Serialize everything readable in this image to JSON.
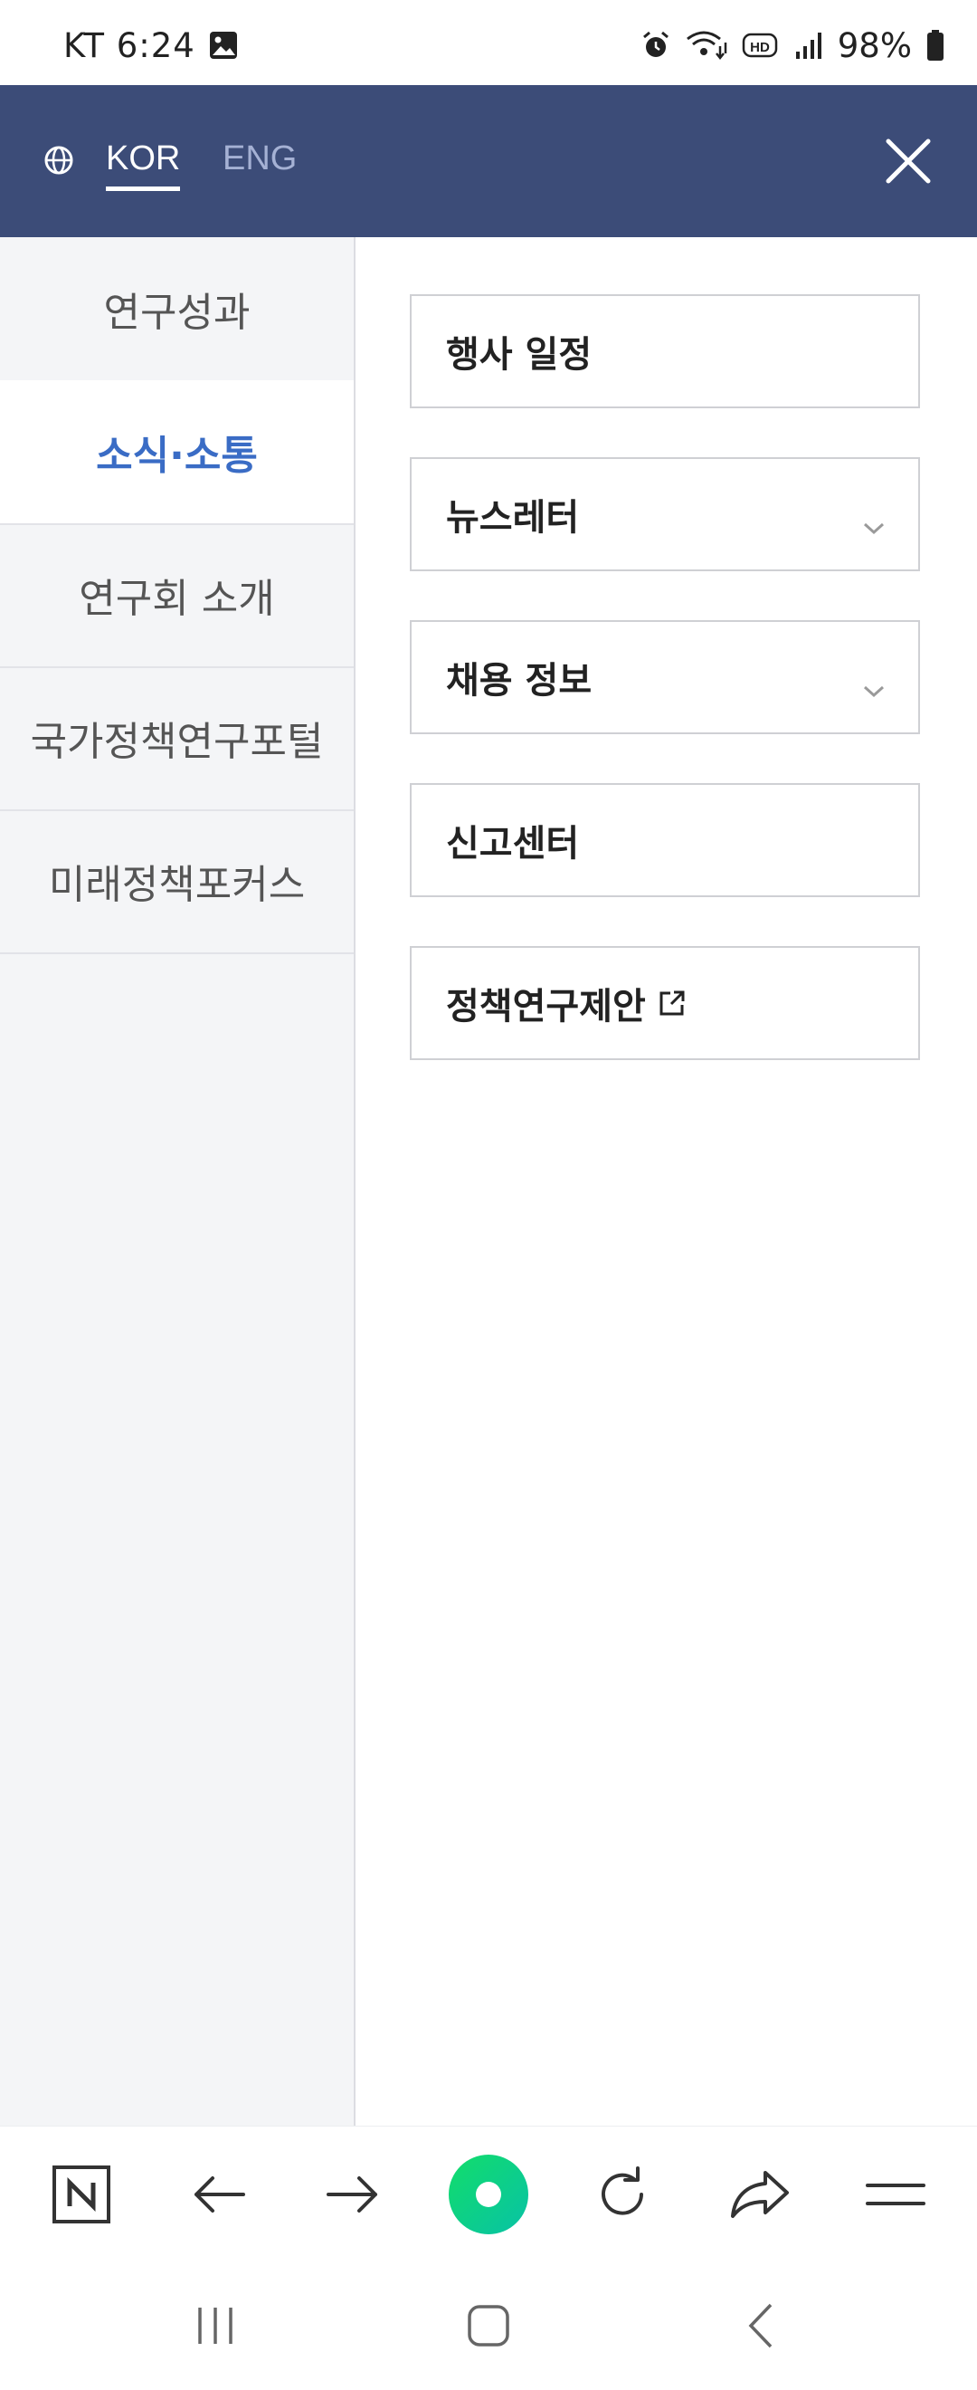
{
  "status_bar": {
    "carrier_time": "KT 6:24",
    "battery_percent": "98%",
    "icons": [
      "image-icon",
      "alarm-icon",
      "wifi-icon",
      "hd-icon",
      "signal-icon",
      "battery-icon"
    ]
  },
  "header": {
    "languages": [
      {
        "label": "KOR",
        "selected": true
      },
      {
        "label": "ENG",
        "selected": false
      }
    ],
    "colors": {
      "background": "#3c4c78",
      "inactive_lang": "#a5b1d4"
    }
  },
  "left_menu": {
    "items": [
      {
        "label": "연구성과",
        "active": false
      },
      {
        "label": "소식·소통",
        "active": true
      },
      {
        "label": "연구회 소개",
        "active": false
      },
      {
        "label": "국가정책연구포털",
        "active": false
      },
      {
        "label": "미래정책포커스",
        "active": false
      }
    ],
    "active_color": "#3a6cc5"
  },
  "sub_menu": {
    "items": [
      {
        "label": "행사 일정",
        "icon": null
      },
      {
        "label": "뉴스레터",
        "icon": "chevron-down-icon"
      },
      {
        "label": "채용 정보",
        "icon": "chevron-down-icon"
      },
      {
        "label": "신고센터",
        "icon": null
      },
      {
        "label": "정책연구제안",
        "icon": "external-link-icon"
      }
    ]
  },
  "toolbar": {
    "icons": [
      "naver-home-icon",
      "back-arrow-icon",
      "forward-arrow-icon",
      "green-dot-icon",
      "refresh-icon",
      "share-icon",
      "menu-icon"
    ],
    "accent": "#10d483"
  },
  "nav_bar": {
    "icons": [
      "recent-apps-icon",
      "home-icon",
      "back-icon"
    ]
  }
}
